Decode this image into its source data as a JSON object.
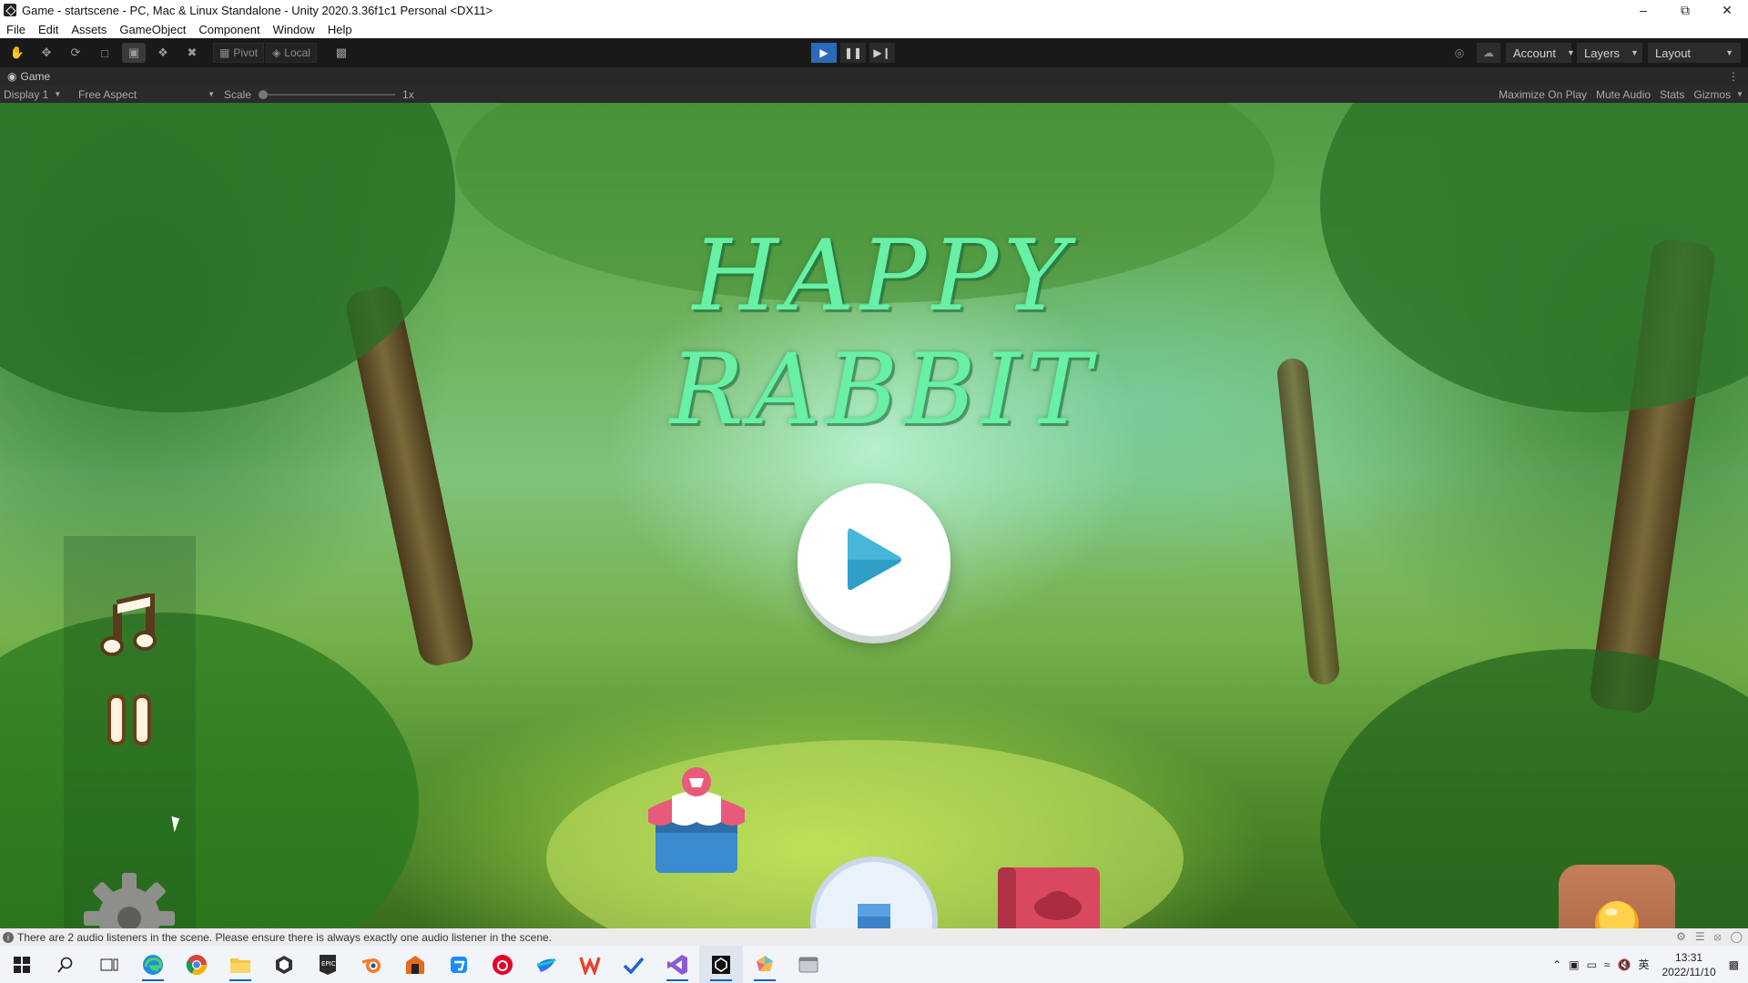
{
  "window": {
    "title": "Game - startscene - PC, Mac & Linux Standalone - Unity 2020.3.36f1c1 Personal <DX11>"
  },
  "menu": [
    "File",
    "Edit",
    "Assets",
    "GameObject",
    "Component",
    "Window",
    "Help"
  ],
  "toolbar": {
    "pivot_label": "Pivot",
    "local_label": "Local",
    "account_label": "Account",
    "layers_label": "Layers",
    "layout_label": "Layout"
  },
  "game_panel": {
    "tab_label": "Game",
    "display_label": "Display 1",
    "aspect_label": "Free Aspect",
    "scale_label": "Scale",
    "scale_value": "1x",
    "maximize_label": "Maximize On Play",
    "mute_label": "Mute Audio",
    "stats_label": "Stats",
    "gizmos_label": "Gizmos"
  },
  "game": {
    "title": "HAPPY RABBIT",
    "colors": {
      "title": "#67f0a6",
      "play": "#2f9fc8"
    }
  },
  "status": {
    "message": "There are 2 audio listeners in the scene. Please ensure there is always exactly one audio listener in the scene."
  },
  "taskbar": {
    "time": "13:31",
    "date": "2022/11/10",
    "ime_label": "英"
  }
}
